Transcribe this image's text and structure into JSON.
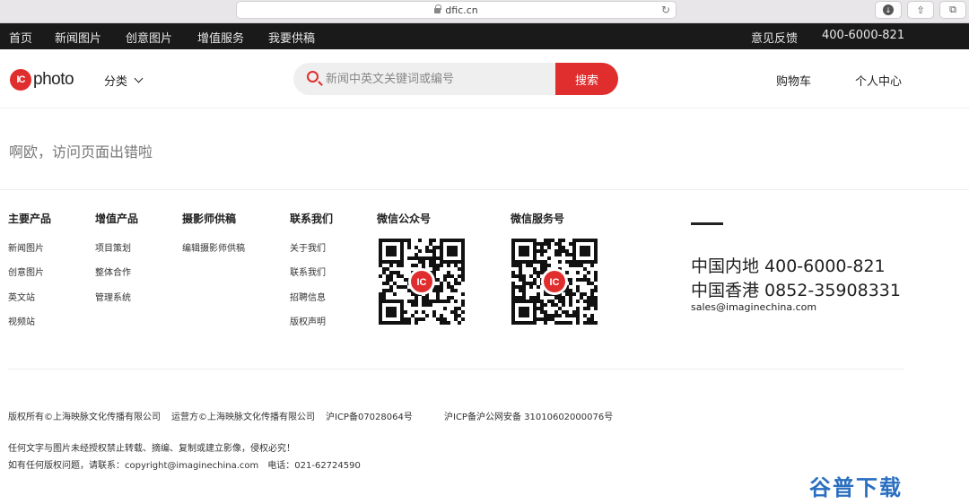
{
  "browser": {
    "url": "dfic.cn"
  },
  "topnav": {
    "left": [
      "首页",
      "新闻图片",
      "创意图片",
      "增值服务",
      "我要供稿"
    ],
    "feedback": "意见反馈",
    "hotline": "400-6000-821"
  },
  "header": {
    "logo_mark": "IC",
    "logo_text": "photo",
    "category": "分类",
    "search_placeholder": "新闻中英文关键词或编号",
    "search_button": "搜索",
    "cart": "购物车",
    "user_center": "个人中心"
  },
  "error": {
    "message": "啊欧，访问页面出错啦"
  },
  "footer": {
    "columns": [
      {
        "title": "主要产品",
        "links": [
          "新闻图片",
          "创意图片",
          "英文站",
          "视频站"
        ]
      },
      {
        "title": "增值产品",
        "links": [
          "项目策划",
          "整体合作",
          "管理系统"
        ]
      },
      {
        "title": "摄影师供稿",
        "links": [
          "编辑摄影师供稿"
        ]
      },
      {
        "title": "联系我们",
        "links": [
          "关于我们",
          "联系我们",
          "招聘信息",
          "版权声明"
        ]
      }
    ],
    "qr": [
      {
        "title": "微信公众号",
        "mark": "IC"
      },
      {
        "title": "微信服务号",
        "mark": "IC"
      }
    ],
    "contact": {
      "mainland": "中国内地 400-6000-821",
      "hongkong": "中国香港 0852-35908331",
      "email": "sales@imaginechina.com"
    },
    "legal": {
      "copyright": "版权所有©上海映脉文化传播有限公司",
      "operator": "运营方©上海映脉文化传播有限公司",
      "icp": "沪ICP备07028064号",
      "security": "沪ICP备沪公网安备 31010602000076号",
      "notice": "任何文字与图片未经授权禁止转载、摘编、复制或建立影像，侵权必究！",
      "copyright_contact": "如有任何版权问题，请联系：copyright@imaginechina.com　电话：021-62724590"
    }
  },
  "watermark": "谷普下载"
}
